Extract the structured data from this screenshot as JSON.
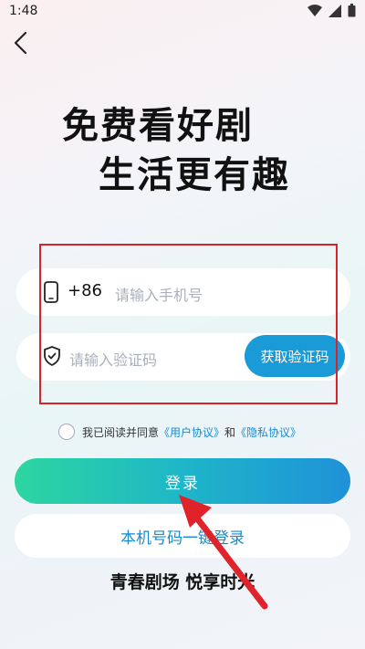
{
  "status": {
    "time": "1:48"
  },
  "hero": {
    "line1": "免费看好剧",
    "line2": "生活更有趣"
  },
  "form": {
    "country_code": "+86",
    "phone_placeholder": "请输入手机号",
    "code_placeholder": "请输入验证码",
    "get_code_label": "获取验证码"
  },
  "agreement": {
    "prefix": "我已阅读并同意",
    "user_agreement": "《用户协议》",
    "and": "和",
    "privacy_policy": "《隐私协议》"
  },
  "buttons": {
    "login": "登录",
    "one_key_login": "本机号码一键登录"
  },
  "slogan": "青春剧场 悦享时光",
  "colors": {
    "accent": "#1a9ad6",
    "annotation": "#d8232a",
    "gradient_start": "#2dd6a0",
    "gradient_end": "#1f91d8"
  }
}
